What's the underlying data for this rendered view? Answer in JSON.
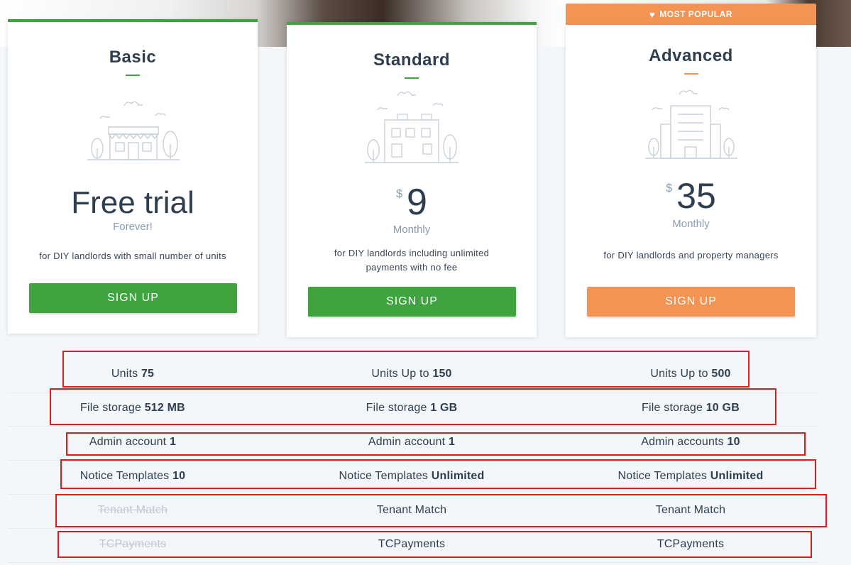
{
  "popular_badge": {
    "icon": "heart-icon",
    "label": "MOST POPULAR"
  },
  "plans": [
    {
      "name": "Basic",
      "price_main": "Free trial",
      "price_sub": "Forever!",
      "description": "for DIY landlords with small number of units",
      "button": "SIGN UP",
      "accent": "#3fa43f"
    },
    {
      "name": "Standard",
      "currency": "$",
      "price_main": "9",
      "price_sub": "Monthly",
      "description": "for DIY landlords including unlimited payments with no fee",
      "button": "SIGN UP",
      "accent": "#3fa43f"
    },
    {
      "name": "Advanced",
      "currency": "$",
      "price_main": "35",
      "price_sub": "Monthly",
      "description": "for DIY landlords and property managers",
      "button": "SIGN UP",
      "accent": "#f39455"
    }
  ],
  "features": [
    {
      "cells": [
        {
          "label": "Units",
          "value": "75"
        },
        {
          "label": "Units Up to",
          "value": "150"
        },
        {
          "label": "Units Up to",
          "value": "500"
        }
      ]
    },
    {
      "cells": [
        {
          "label": "File storage",
          "value": "512 MB"
        },
        {
          "label": "File storage",
          "value": "1 GB"
        },
        {
          "label": "File storage",
          "value": "10 GB"
        }
      ]
    },
    {
      "cells": [
        {
          "label": "Admin account",
          "value": "1"
        },
        {
          "label": "Admin account",
          "value": "1"
        },
        {
          "label": "Admin accounts",
          "value": "10"
        }
      ]
    },
    {
      "cells": [
        {
          "label": "Notice Templates",
          "value": "10"
        },
        {
          "label": "Notice Templates",
          "value": "Unlimited"
        },
        {
          "label": "Notice Templates",
          "value": "Unlimited"
        }
      ]
    },
    {
      "cells": [
        {
          "label": "Tenant Match",
          "value": "",
          "disabled": true
        },
        {
          "label": "Tenant Match",
          "value": ""
        },
        {
          "label": "Tenant Match",
          "value": ""
        }
      ]
    },
    {
      "cells": [
        {
          "label": "TCPayments",
          "value": "",
          "disabled": true
        },
        {
          "label": "TCPayments",
          "value": ""
        },
        {
          "label": "TCPayments",
          "value": ""
        }
      ]
    }
  ],
  "colors": {
    "green": "#3fa43f",
    "orange": "#f39455",
    "highlight": "#e01b1b"
  }
}
